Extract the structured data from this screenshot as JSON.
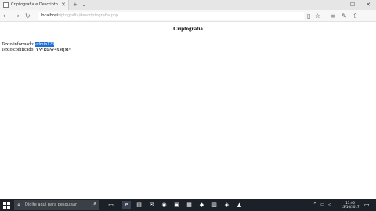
{
  "browser": {
    "tab_title": "Criptografia e Descripto",
    "tab_close": "✕",
    "new_tab": "+",
    "tab_list": "⌄",
    "win_min": "—",
    "win_max": "☐",
    "win_close": "✕",
    "back_icon": "←",
    "forward_icon": "→",
    "refresh_icon": "↻",
    "address_host": "localhost",
    "address_path": "/criptografia/descriptografia.php",
    "reading_icon": "▯",
    "favorite_icon": "☆",
    "hub_icon": "≡",
    "note_icon": "✎",
    "share_icon": "⇧",
    "more_icon": "⋯"
  },
  "page": {
    "title": "Criptografia",
    "line1_label": "Texto informado: ",
    "line1_value": "admin123",
    "line2_label": "Texto codificado: ",
    "line2_value": "YWRtaW4xMjM="
  },
  "taskbar": {
    "search_placeholder": "Digite aqui para pesquisar",
    "search_icon": "⌕",
    "mic_icon": "🎤",
    "icons": [
      "▭",
      "e",
      "▤",
      "✉",
      "◉",
      "▣",
      "▦",
      "◆",
      "▥",
      "◈",
      "▲"
    ],
    "tray_up": "^",
    "tray_net": "▭",
    "tray_vol": "◁",
    "time": "15:46",
    "date": "13/10/2017",
    "notif_icon": "▭"
  },
  "colors": {
    "selection": "#1e70d2",
    "taskbar": "#1c2028"
  }
}
